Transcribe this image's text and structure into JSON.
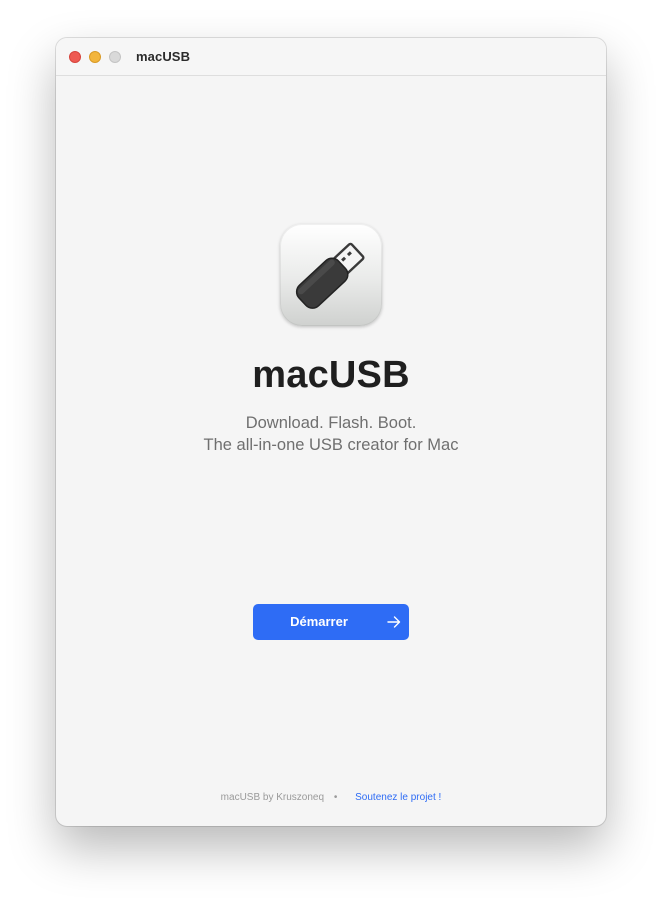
{
  "window": {
    "title": "macUSB"
  },
  "main": {
    "app_name": "macUSB",
    "tagline_line1": "Download. Flash. Boot.",
    "tagline_line2": "The all-in-one USB creator for Mac",
    "start_button_label": "Démarrer",
    "start_button_icon": "arrow-right-icon",
    "app_icon": "usb-drive-icon"
  },
  "footer": {
    "credit": "macUSB by Kruszoneq",
    "separator": "•",
    "support_link": "Soutenez le projet !"
  },
  "colors": {
    "accent": "#2e6cf5",
    "window_background": "#f5f5f5",
    "close": "#ee5a52",
    "minimize": "#f2b53c",
    "zoom_disabled": "#d9d9d9"
  }
}
